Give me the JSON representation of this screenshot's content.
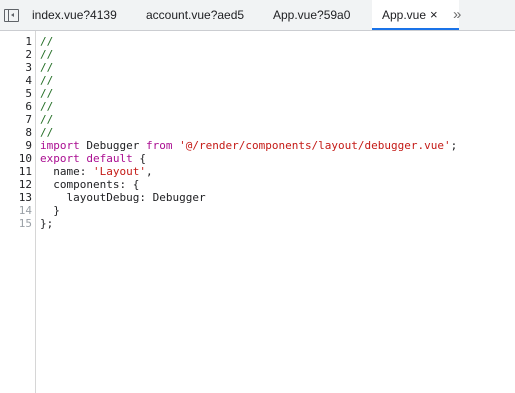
{
  "tabs": [
    {
      "label": "index.vue?4139"
    },
    {
      "label": "account.vue?aed5"
    },
    {
      "label": "App.vue?59a0"
    },
    {
      "label": "App.vue"
    }
  ],
  "tab_close": "×",
  "more_tabs": "»",
  "colors": {
    "comment": "#236e25",
    "keyword": "#aa0d91",
    "string": "#c41a16",
    "active_tab_underline": "#1a73e8"
  },
  "lines": [
    {
      "n": "1",
      "parts": [
        {
          "t": "//",
          "c": "comment"
        }
      ]
    },
    {
      "n": "2",
      "parts": [
        {
          "t": "//",
          "c": "comment"
        }
      ]
    },
    {
      "n": "3",
      "parts": [
        {
          "t": "//",
          "c": "comment"
        }
      ]
    },
    {
      "n": "4",
      "parts": [
        {
          "t": "//",
          "c": "comment"
        }
      ]
    },
    {
      "n": "5",
      "parts": [
        {
          "t": "//",
          "c": "comment"
        }
      ]
    },
    {
      "n": "6",
      "parts": [
        {
          "t": "//",
          "c": "comment"
        }
      ]
    },
    {
      "n": "7",
      "parts": [
        {
          "t": "//",
          "c": "comment"
        }
      ]
    },
    {
      "n": "8",
      "parts": [
        {
          "t": "//",
          "c": "comment"
        }
      ]
    },
    {
      "n": "9",
      "parts": [
        {
          "t": "import",
          "c": "kw"
        },
        {
          "t": " Debugger ",
          "c": "txt"
        },
        {
          "t": "from",
          "c": "kw"
        },
        {
          "t": " ",
          "c": "txt"
        },
        {
          "t": "'@/render/components/layout/debugger.vue'",
          "c": "str"
        },
        {
          "t": ";",
          "c": "txt"
        }
      ]
    },
    {
      "n": "10",
      "parts": [
        {
          "t": "export",
          "c": "kw"
        },
        {
          "t": " ",
          "c": "txt"
        },
        {
          "t": "default",
          "c": "kw"
        },
        {
          "t": " {",
          "c": "txt"
        }
      ]
    },
    {
      "n": "11",
      "parts": [
        {
          "t": "  name: ",
          "c": "txt"
        },
        {
          "t": "'Layout'",
          "c": "str"
        },
        {
          "t": ",",
          "c": "txt"
        }
      ]
    },
    {
      "n": "12",
      "parts": [
        {
          "t": "  components: {",
          "c": "txt"
        }
      ]
    },
    {
      "n": "13",
      "parts": [
        {
          "t": "    layoutDebug: Debugger",
          "c": "txt"
        }
      ]
    },
    {
      "n": "14",
      "dim": true,
      "parts": [
        {
          "t": "  }",
          "c": "txt"
        }
      ]
    },
    {
      "n": "15",
      "dim": true,
      "parts": [
        {
          "t": "};",
          "c": "txt"
        }
      ]
    }
  ]
}
